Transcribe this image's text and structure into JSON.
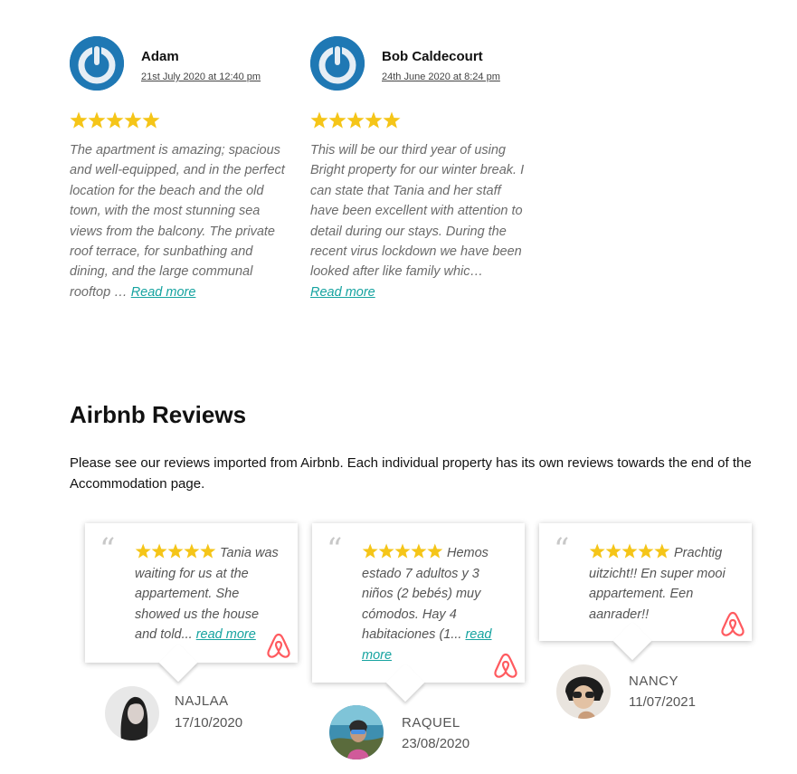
{
  "reviews": [
    {
      "name": "Adam",
      "date": "21st July 2020 at 12:40 pm",
      "rating": 5,
      "text": "The apartment is amazing; spacious and well-equipped, and in the perfect location for the beach and the old town, with the most stunning sea views from the balcony. The private roof terrace, for sunbathing and dining, and the large communal rooftop …",
      "read_more": "Read more"
    },
    {
      "name": "Bob Caldecourt",
      "date": "24th June 2020 at 8:24 pm",
      "rating": 5,
      "text": "This will be our third year of using Bright property for our winter break. I can state that Tania and her staff have been excellent with attention to detail during our stays. During the recent virus lockdown we have been looked after like family whic…",
      "read_more": "Read more"
    }
  ],
  "airbnb": {
    "heading": "Airbnb Reviews",
    "intro": "Please see our reviews imported from Airbnb. Each individual property has its own reviews towards the end of the Accommodation page.",
    "reviews": [
      {
        "rating": 5,
        "text": "Tania was waiting for us at the appartement. She showed us the house and told...",
        "read_more": "read more",
        "name": "NAJLAA",
        "date": "17/10/2020"
      },
      {
        "rating": 5,
        "text": "Hemos estado 7 adultos y 3 niños (2 bebés) muy cómodos. Hay 4 habitaciones (1...",
        "read_more": "read more",
        "name": "RAQUEL",
        "date": "23/08/2020"
      },
      {
        "rating": 5,
        "text": "Prachtig uitzicht!! En super mooi appartement. Een aanrader!!",
        "read_more": "",
        "name": "NANCY",
        "date": "11/07/2021"
      }
    ]
  },
  "colors": {
    "star": "#f5c518",
    "link": "#16a3a0",
    "avatar_blue": "#1f78b4",
    "airbnb": "#ff5a5f"
  },
  "icons": [
    "power-avatar-icon",
    "star-icon",
    "quote-icon",
    "airbnb-logo-icon"
  ]
}
